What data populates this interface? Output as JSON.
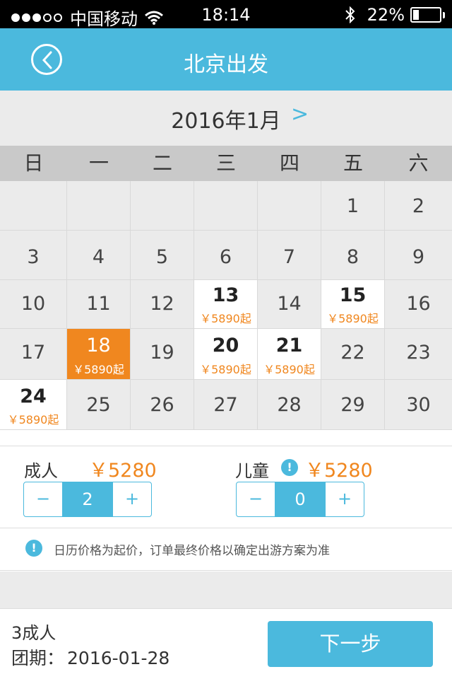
{
  "status_bar": {
    "carrier": "中国移动",
    "time": "18:14",
    "battery": "22%",
    "battery_level": 0.22,
    "signal_bars_filled": 3,
    "signal_bars_total": 5,
    "icons": [
      "wifi-icon",
      "bluetooth-icon",
      "battery-icon"
    ]
  },
  "nav": {
    "title": "北京出发",
    "back_icon": "chevron-left-circle-icon"
  },
  "calendar": {
    "month_label": "2016年1月",
    "next_label": ">",
    "weekdays": [
      "日",
      "一",
      "二",
      "三",
      "四",
      "五",
      "六"
    ],
    "weeks": [
      [
        {
          "day": ""
        },
        {
          "day": ""
        },
        {
          "day": ""
        },
        {
          "day": ""
        },
        {
          "day": ""
        },
        {
          "day": "1"
        },
        {
          "day": "2"
        }
      ],
      [
        {
          "day": "3"
        },
        {
          "day": "4"
        },
        {
          "day": "5"
        },
        {
          "day": "6"
        },
        {
          "day": "7"
        },
        {
          "day": "8"
        },
        {
          "day": "9"
        }
      ],
      [
        {
          "day": "10"
        },
        {
          "day": "11"
        },
        {
          "day": "12"
        },
        {
          "day": "13",
          "price": "￥5890起",
          "available": true
        },
        {
          "day": "14"
        },
        {
          "day": "15",
          "price": "￥5890起",
          "available": true
        },
        {
          "day": "16"
        }
      ],
      [
        {
          "day": "17"
        },
        {
          "day": "18",
          "price": "￥5890起",
          "available": true,
          "selected": true
        },
        {
          "day": "19"
        },
        {
          "day": "20",
          "price": "￥5890起",
          "available": true
        },
        {
          "day": "21",
          "price": "￥5890起",
          "available": true
        },
        {
          "day": "22"
        },
        {
          "day": "23"
        }
      ],
      [
        {
          "day": "24",
          "price": "￥5890起",
          "available": true
        },
        {
          "day": "25"
        },
        {
          "day": "26"
        },
        {
          "day": "27"
        },
        {
          "day": "28"
        },
        {
          "day": "29"
        },
        {
          "day": "30"
        }
      ]
    ]
  },
  "passengers": {
    "adult": {
      "label": "成人",
      "price": "￥5280",
      "count": "2",
      "minus": "−",
      "plus": "+"
    },
    "child": {
      "label": "儿童",
      "price": "￥5280",
      "count": "0",
      "minus": "−",
      "plus": "+",
      "info_icon": "!"
    }
  },
  "notice": {
    "icon": "!",
    "text": "日历价格为起价，订单最终价格以确定出游方案为准"
  },
  "footer": {
    "summary": "3成人",
    "date_label": "团期：",
    "date_value": "2016-01-28",
    "next_button": "下一步"
  },
  "colors": {
    "accent": "#4bb9dd",
    "price": "#f0871f",
    "selected": "#f0871f",
    "cell_bg": "#ebebeb",
    "weekday_bg": "#c9c9c9"
  }
}
